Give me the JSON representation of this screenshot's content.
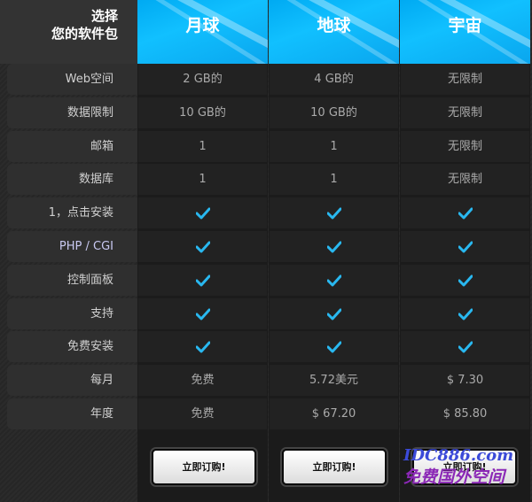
{
  "corner": {
    "line1": "选择",
    "line2": "您的软件包"
  },
  "plans": [
    {
      "name": "月球"
    },
    {
      "name": "地球"
    },
    {
      "name": "宇宙"
    }
  ],
  "rows": [
    {
      "label": "Web空间",
      "values": [
        "2 GB的",
        "4 GB的",
        "无限制"
      ]
    },
    {
      "label": "数据限制",
      "values": [
        "10 GB的",
        "10 GB的",
        "无限制"
      ]
    },
    {
      "label": "邮箱",
      "values": [
        "1",
        "1",
        "无限制"
      ]
    },
    {
      "label": "数据库",
      "values": [
        "1",
        "1",
        "无限制"
      ]
    },
    {
      "label": "1，点击安装",
      "values": [
        "check",
        "check",
        "check"
      ]
    },
    {
      "label": "PHP / CGI",
      "values": [
        "check",
        "check",
        "check"
      ]
    },
    {
      "label": "控制面板",
      "values": [
        "check",
        "check",
        "check"
      ]
    },
    {
      "label": "支持",
      "values": [
        "check",
        "check",
        "check"
      ]
    },
    {
      "label": "免费安装",
      "values": [
        "check",
        "check",
        "check"
      ]
    },
    {
      "label": "每月",
      "values": [
        "免费",
        "5.72美元",
        "$ 7.30"
      ]
    },
    {
      "label": "年度",
      "values": [
        "免费",
        "$ 67.20",
        "$ 85.80"
      ]
    }
  ],
  "order_button_label": "立即订购!",
  "watermark": {
    "line1": "IDC886.com",
    "line2": "免费国外空间"
  },
  "colors": {
    "accent": "#11b5f5",
    "check": "#29b8f0"
  },
  "icons": {
    "check": "check-icon"
  }
}
